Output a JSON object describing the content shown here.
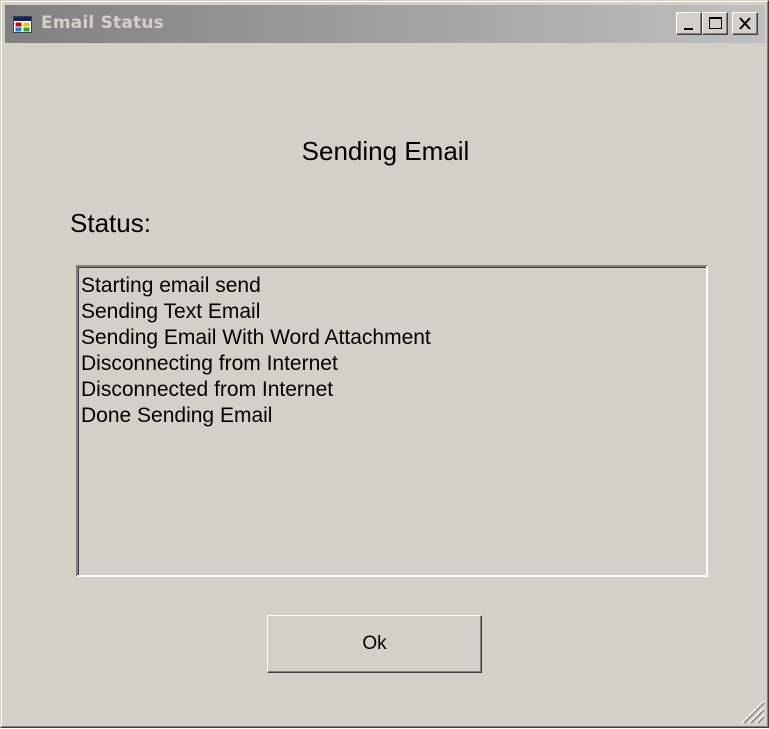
{
  "window": {
    "title": "Email Status",
    "title_icon": "application-window-icon",
    "controls": {
      "minimize": "minimize-icon",
      "maximize": "maximize-icon",
      "close": "close-icon"
    }
  },
  "main": {
    "heading": "Sending Email",
    "status_label": "Status:",
    "log_lines": [
      "Starting email send",
      "Sending Text Email",
      "Sending Email With Word Attachment",
      "Disconnecting from Internet",
      "Disconnected from Internet",
      "Done Sending Email"
    ],
    "ok_label": "Ok"
  },
  "colors": {
    "face": "#d4d0c8",
    "titlebar_inactive_start": "#808080",
    "titlebar_inactive_end": "#c0c0c0",
    "title_text": "#d4d0c8"
  }
}
